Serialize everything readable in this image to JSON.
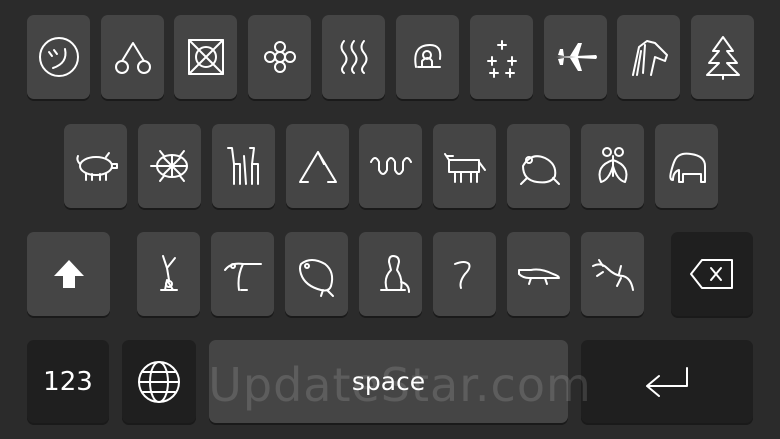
{
  "keyboard": {
    "row1": [
      {
        "icon": "smiley-katakana-icon"
      },
      {
        "icon": "cherries-icon"
      },
      {
        "icon": "celtic-knot-icon"
      },
      {
        "icon": "flower-ornament-icon"
      },
      {
        "icon": "steam-waves-icon"
      },
      {
        "icon": "shell-glyph-icon"
      },
      {
        "icon": "sparkle-dots-icon"
      },
      {
        "icon": "airplane-icon"
      },
      {
        "icon": "horse-head-icon"
      },
      {
        "icon": "pine-tree-icon"
      }
    ],
    "row2": [
      {
        "icon": "pig-icon"
      },
      {
        "icon": "turtle-icon"
      },
      {
        "icon": "giraffes-icon"
      },
      {
        "icon": "mountain-pose-icon"
      },
      {
        "icon": "snake-icon"
      },
      {
        "icon": "ox-icon"
      },
      {
        "icon": "frog-icon"
      },
      {
        "icon": "fly-icon"
      },
      {
        "icon": "elephant-icon"
      }
    ],
    "row3": [
      {
        "icon": "handstand-figure-icon"
      },
      {
        "icon": "heron-icon"
      },
      {
        "icon": "manatee-icon"
      },
      {
        "icon": "meerkat-icon"
      },
      {
        "icon": "worm-icon"
      },
      {
        "icon": "crocodile-icon"
      },
      {
        "icon": "lizard-icon"
      }
    ],
    "shift_icon": "shift-arrow-icon",
    "backspace_icon": "backspace-icon",
    "numbers_label": "123",
    "globe_icon": "globe-icon",
    "space_label": "space",
    "return_icon": "return-arrow-icon"
  },
  "watermark": "UpdateStar.com",
  "colors": {
    "background": "#2b2b2b",
    "key": "#454545",
    "special_key": "#1f1f1f",
    "text": "#ffffff"
  }
}
